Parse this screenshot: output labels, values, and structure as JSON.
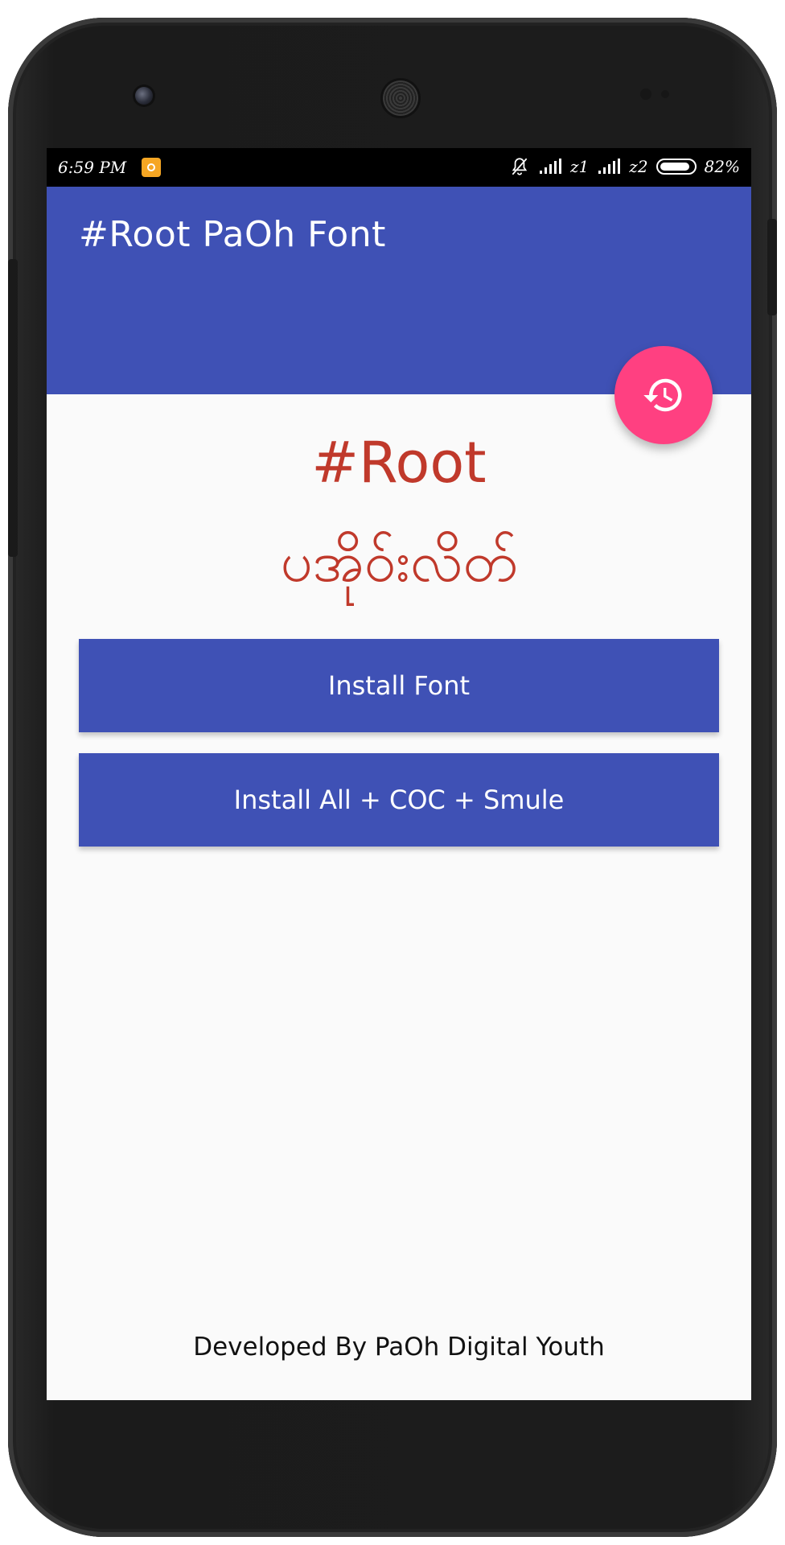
{
  "status_bar": {
    "time": "6:59 PM",
    "sim1": "z1",
    "sim2": "z2",
    "battery": "82%",
    "icons": [
      "notification-app-icon",
      "bell-off-icon",
      "signal-icon",
      "signal-icon",
      "battery-icon"
    ]
  },
  "app_bar": {
    "title": "#Root PaOh Font",
    "color": "#3f51b5"
  },
  "fab": {
    "icon": "history-icon",
    "color": "#ff4081"
  },
  "hero": {
    "title": "#Root",
    "subtitle": "ပအိုဝ်းလိတ်",
    "color": "#c0392b"
  },
  "buttons": {
    "install_font": "Install Font",
    "install_all": "Install All + COC + Smule"
  },
  "footer": {
    "text": "Developed By PaOh Digital Youth"
  }
}
